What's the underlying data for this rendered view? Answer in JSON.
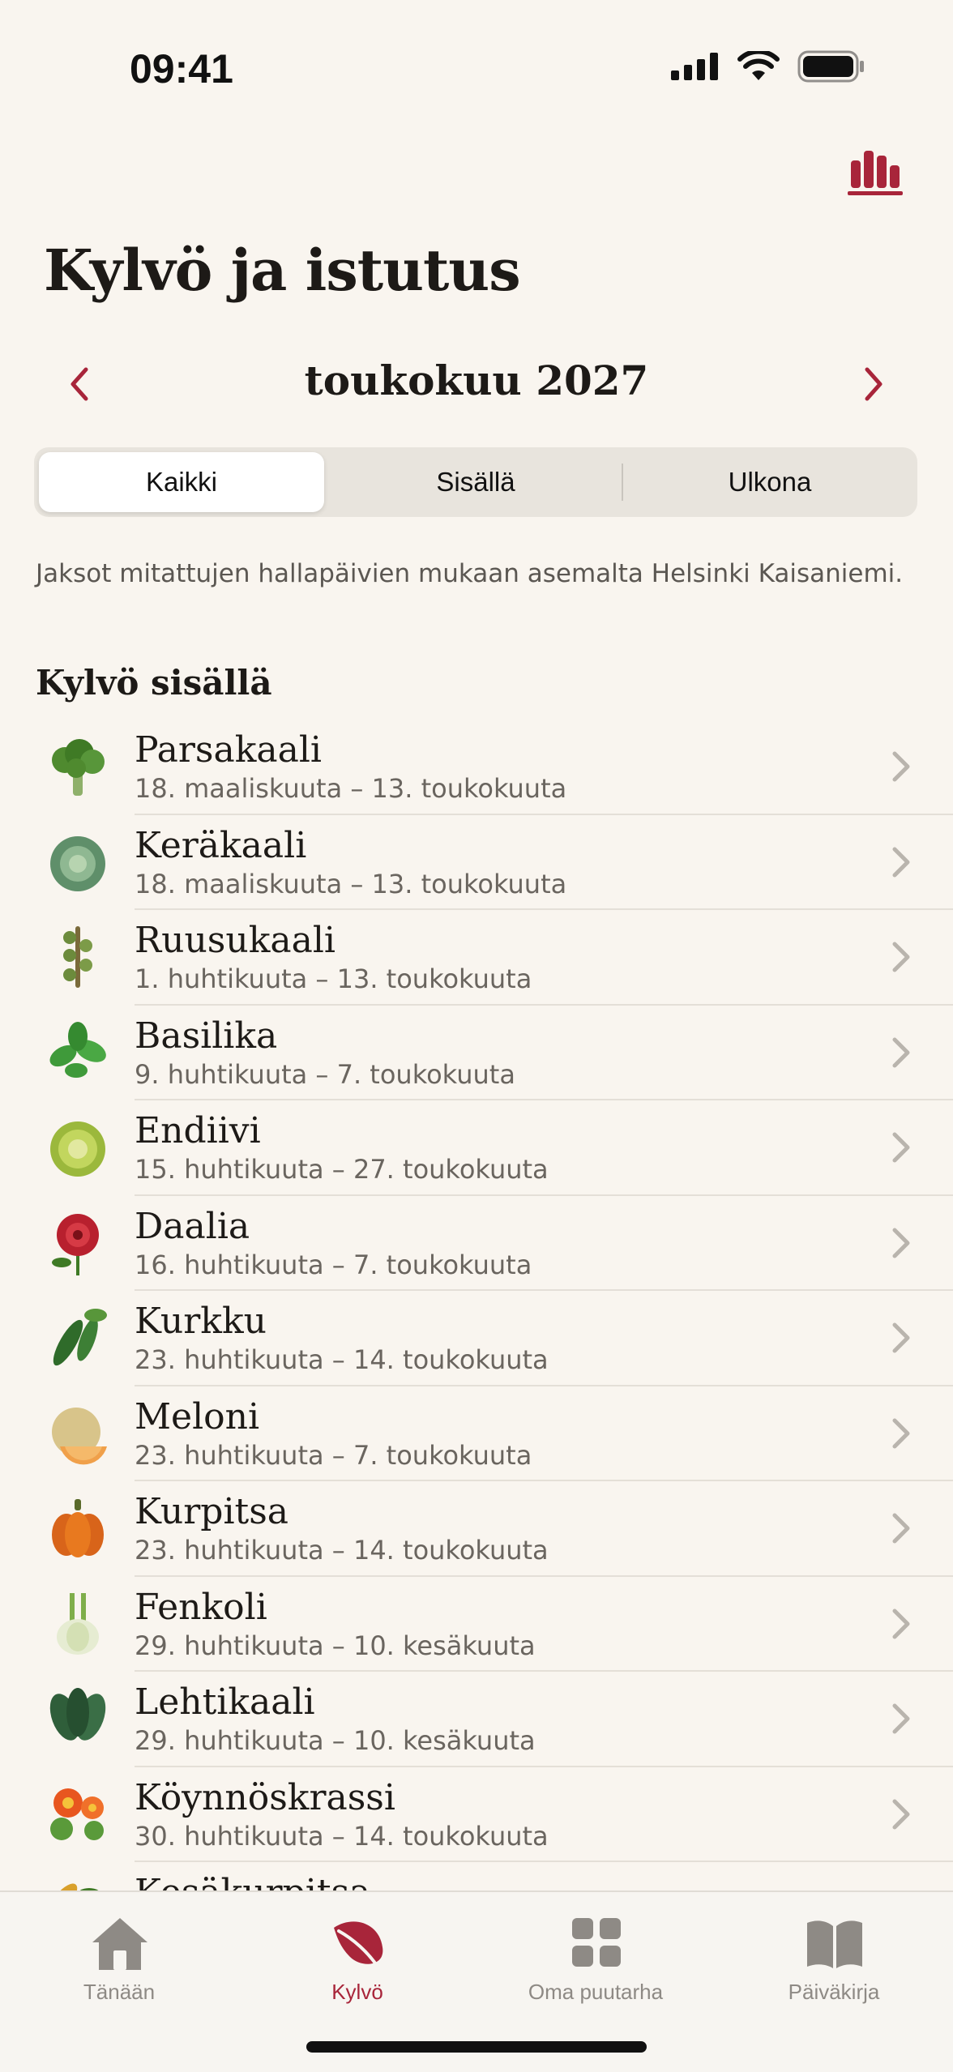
{
  "status_bar": {
    "time": "09:41"
  },
  "header": {
    "title": "Kylvö ja istutus",
    "stats_icon": "bar-chart-icon"
  },
  "month_nav": {
    "label": "toukokuu 2027"
  },
  "segments": [
    {
      "label": "Kaikki",
      "active": true
    },
    {
      "label": "Sisällä",
      "active": false
    },
    {
      "label": "Ulkona",
      "active": false
    }
  ],
  "info": "Jaksot mitattujen hallapäivien mukaan asemalta Helsinki Kaisaniemi.",
  "section": {
    "title": "Kylvö sisällä"
  },
  "plants": [
    {
      "name": "Parsakaali",
      "dates": "18. maaliskuuta – 13. toukokuuta",
      "icon": "broccoli-icon",
      "color": "#4f8a2f"
    },
    {
      "name": "Keräkaali",
      "dates": "18. maaliskuuta – 13. toukokuuta",
      "icon": "cabbage-icon",
      "color": "#5f8f6a"
    },
    {
      "name": "Ruusukaali",
      "dates": "1. huhtikuuta – 13. toukokuuta",
      "icon": "brussels-sprouts-icon",
      "color": "#6c8b3c"
    },
    {
      "name": "Basilika",
      "dates": "9. huhtikuuta – 7. toukokuuta",
      "icon": "basil-icon",
      "color": "#3f9a3a"
    },
    {
      "name": "Endiivi",
      "dates": "15. huhtikuuta – 27. toukokuuta",
      "icon": "endive-icon",
      "color": "#9bb83c"
    },
    {
      "name": "Daalia",
      "dates": "16. huhtikuuta – 7. toukokuuta",
      "icon": "dahlia-icon",
      "color": "#b8202e"
    },
    {
      "name": "Kurkku",
      "dates": "23. huhtikuuta – 14. toukokuuta",
      "icon": "cucumber-icon",
      "color": "#2f6b2a"
    },
    {
      "name": "Meloni",
      "dates": "23. huhtikuuta – 7. toukokuuta",
      "icon": "melon-icon",
      "color": "#e0a25a"
    },
    {
      "name": "Kurpitsa",
      "dates": "23. huhtikuuta – 14. toukokuuta",
      "icon": "pumpkin-icon",
      "color": "#e2731d"
    },
    {
      "name": "Fenkoli",
      "dates": "29. huhtikuuta – 10. kesäkuuta",
      "icon": "fennel-icon",
      "color": "#c9d8a8"
    },
    {
      "name": "Lehtikaali",
      "dates": "29. huhtikuuta – 10. kesäkuuta",
      "icon": "kale-icon",
      "color": "#2f5e3a"
    },
    {
      "name": "Köynnöskrassi",
      "dates": "30. huhtikuuta – 14. toukokuuta",
      "icon": "nasturtium-icon",
      "color": "#e8561f"
    },
    {
      "name": "Kesäkurpitsa",
      "dates": "",
      "icon": "zucchini-icon",
      "color": "#d9a02a"
    }
  ],
  "tabs": [
    {
      "label": "Tänään",
      "icon": "home-icon",
      "active": false
    },
    {
      "label": "Kylvö",
      "icon": "leaf-icon",
      "active": true
    },
    {
      "label": "Oma puutarha",
      "icon": "grid-icon",
      "active": false
    },
    {
      "label": "Päiväkirja",
      "icon": "book-icon",
      "active": false
    }
  ],
  "colors": {
    "accent": "#a8253a",
    "background": "#f9f5ef",
    "inactive_tab": "#8e8a85"
  }
}
